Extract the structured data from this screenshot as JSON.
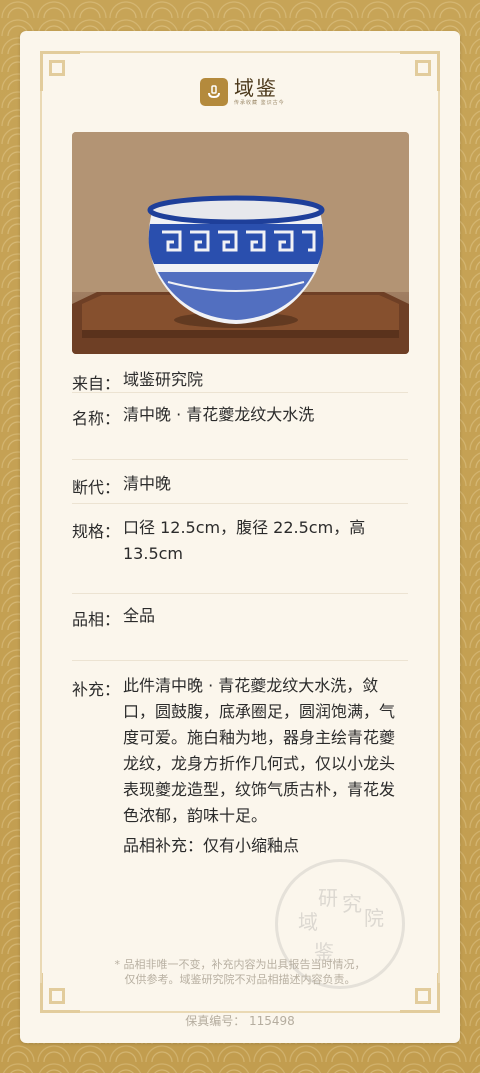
{
  "brand": {
    "name": "域鉴",
    "slogan": "传承收藏 鉴识古今"
  },
  "fields": [
    {
      "label": "来自：",
      "value": "域鉴研究院"
    },
    {
      "label": "名称：",
      "value": "清中晚 · 青花夔龙纹大水洗"
    },
    {
      "label": "断代：",
      "value": "清中晚"
    },
    {
      "label": "规格：",
      "value": "口径 12.5cm，腹径 22.5cm，高 13.5cm"
    },
    {
      "label": "品相：",
      "value": "全品"
    },
    {
      "label": "补充：",
      "value": "此件清中晚 · 青花夔龙纹大水洗，敛口，圆鼓腹，底承圈足，圆润饱满，气度可爱。施白釉为地，器身主绘青花夔龙纹，龙身方折作几何式，仅以小龙头表现夔龙造型，纹饰气质古朴，青花发色浓郁，韵味十足。",
      "extra": "品相补充：仅有小缩釉点"
    }
  ],
  "stamp_text": [
    "研",
    "究",
    "院",
    "域",
    "鉴"
  ],
  "disclaimer": {
    "line1": "* 品相非唯一不变，补充内容为出具报告当时情况，",
    "line2": "仅供参考。域鉴研究院不对品相描述内容负责。"
  },
  "serial": "保真编号：  115498",
  "colors": {
    "gold": "#c9a55a",
    "card": "#fbf6ec",
    "blue": "#1e3f9a"
  }
}
